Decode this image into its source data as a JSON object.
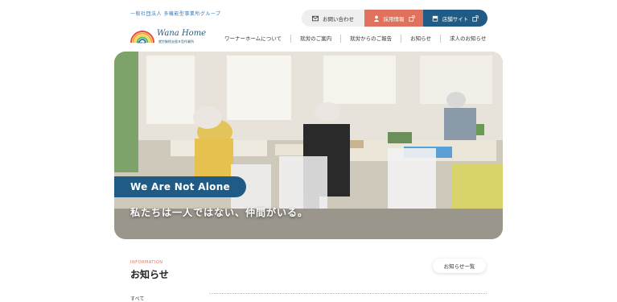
{
  "header": {
    "tagline": "一般社団法人 多機能型事業所グループ",
    "contact_label": "お問い合わせ",
    "recruit_label": "採用情報",
    "store_label": "店舗サイト",
    "logo_brand": "Wana Home",
    "logo_sub": "就労継続支援Ｂ型作業所",
    "logo_mark_text": "Wana"
  },
  "nav": {
    "items": [
      {
        "label": "ワーナーホームについて"
      },
      {
        "label": "就労のご案内"
      },
      {
        "label": "就労からのご報告"
      },
      {
        "label": "お知らせ"
      },
      {
        "label": "求人のお知らせ"
      }
    ]
  },
  "hero": {
    "badge": "We Are Not Alone",
    "subtitle": "私たちは一人ではない、仲間がいる。"
  },
  "info": {
    "label": "INFORMATION",
    "title": "お知らせ",
    "more_label": "お知らせ一覧",
    "tab_all": "すべて"
  },
  "colors": {
    "primary": "#1f5b84",
    "accent": "#e0725d",
    "light": "#efefef"
  }
}
